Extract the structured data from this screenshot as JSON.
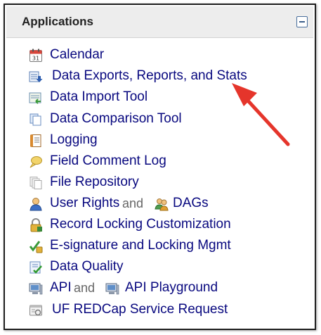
{
  "panel": {
    "title": "Applications"
  },
  "items": [
    {
      "label": "Calendar",
      "icon": "calendar-icon"
    },
    {
      "label": "Data Exports, Reports, and Stats",
      "icon": "data-export-icon"
    },
    {
      "label": "Data Import Tool",
      "icon": "data-import-icon"
    },
    {
      "label": "Data Comparison Tool",
      "icon": "documents-icon"
    },
    {
      "label": "Logging",
      "icon": "logging-icon"
    },
    {
      "label": "Field Comment Log",
      "icon": "comment-balloon-icon"
    },
    {
      "label": "File Repository",
      "icon": "file-repository-icon"
    },
    {
      "label": "User Rights",
      "and": "and",
      "label2": "DAGs",
      "icon": "user-icon",
      "icon2": "group-icon"
    },
    {
      "label": "Record Locking Customization",
      "icon": "lock-icon"
    },
    {
      "label": "E-signature and Locking Mgmt",
      "icon": "signature-shield-icon"
    },
    {
      "label": "Data Quality",
      "icon": "checklist-icon"
    },
    {
      "label": "API",
      "and": "and",
      "label2": "API Playground",
      "icon": "computer-icon",
      "icon2": "computer-icon"
    },
    {
      "label": "UF REDCap Service Request",
      "icon": "service-request-icon"
    }
  ],
  "annotation": {
    "arrow_color": "#e5352b",
    "points_to": "Data Exports, Reports, and Stats"
  }
}
